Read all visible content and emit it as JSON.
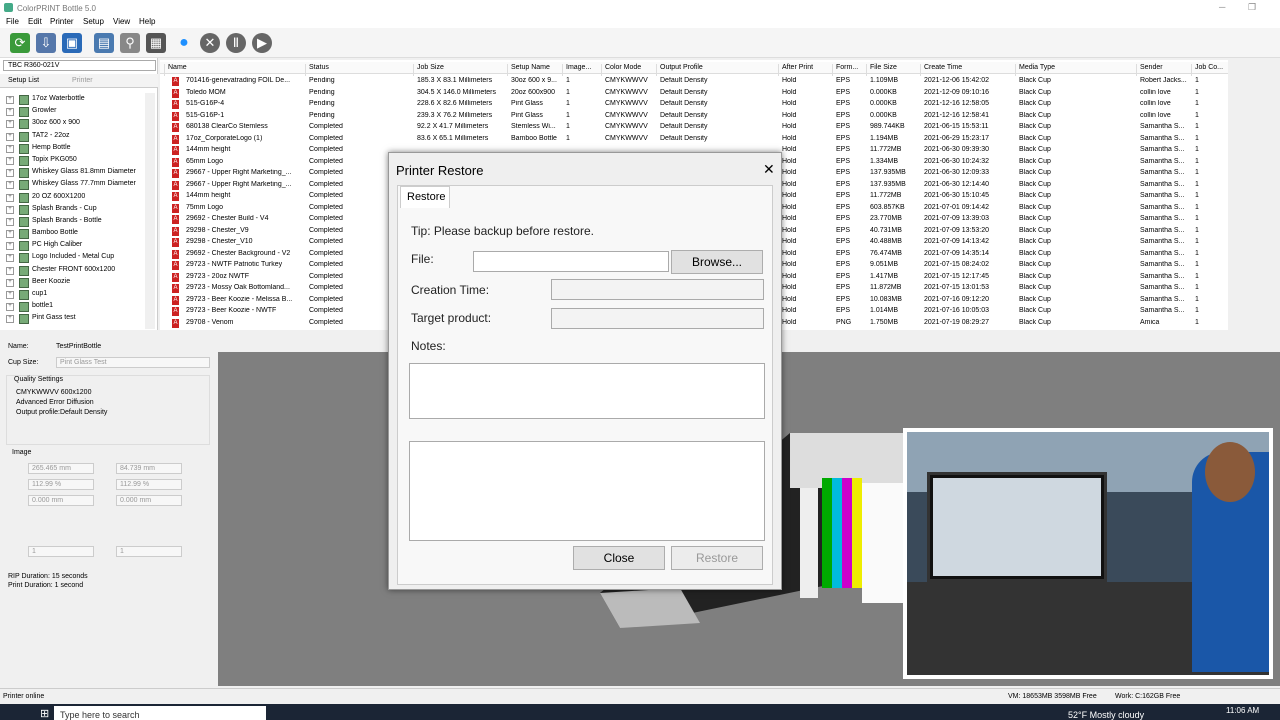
{
  "app": {
    "title": "ColorPRINT Bottle 5.0"
  },
  "menu": [
    "File",
    "Edit",
    "Printer",
    "Setup",
    "View",
    "Help"
  ],
  "printer_select": "TBC R360-021V",
  "left_tabs": {
    "setup_list": "Setup List",
    "printer": "Printer"
  },
  "setups": [
    "17oz Waterbottle",
    "Growler",
    "30oz 600 x 900",
    "TAT2 - 22oz",
    "Hemp Bottle",
    "Topix PKG050",
    "Whiskey Glass 81.8mm Diameter",
    "Whiskey Glass 77.7mm Diameter",
    "20 OZ 600X1200",
    "Splash Brands - Cup",
    "Splash Brands - Bottle",
    "Bamboo Bottle",
    "PC High Caliber",
    "Logo Included - Metal Cup",
    "Chester FRONT 600x1200",
    "Beer Koozie",
    "cup1",
    "bottle1",
    "Pint Gass test"
  ],
  "grid": {
    "headers": [
      "Name",
      "Status",
      "Job Size",
      "Setup Name",
      "Image...",
      "Color Mode",
      "Output Profile",
      "After Print",
      "Form...",
      "File Size",
      "Create Time",
      "Media Type",
      "Sender",
      "Job Co..."
    ],
    "rows": [
      [
        "701416-genevatrading FOIL De...",
        "Pending",
        "185.3 X 83.1 Millimeters",
        "30oz 600 x 9...",
        "1",
        "CMYKWWVV",
        "Default Density",
        "Hold",
        "EPS",
        "1.109MB",
        "2021-12-06 15:42:02",
        "Black Cup",
        "Robert Jacks...",
        "1"
      ],
      [
        "Toledo MOM",
        "Pending",
        "304.5 X 146.0 Millimeters",
        "20oz 600x900",
        "1",
        "CMYKWWVV",
        "Default Density",
        "Hold",
        "EPS",
        "0.000KB",
        "2021-12-09 09:10:16",
        "Black Cup",
        "collin love",
        "1"
      ],
      [
        "515-G16P-4",
        "Pending",
        "228.6 X 82.6 Millimeters",
        "Pint Glass",
        "1",
        "CMYKWWVV",
        "Default Density",
        "Hold",
        "EPS",
        "0.000KB",
        "2021-12-16 12:58:05",
        "Black Cup",
        "collin love",
        "1"
      ],
      [
        "515-G16P-1",
        "Pending",
        "239.3 X 76.2 Millimeters",
        "Pint Glass",
        "1",
        "CMYKWWVV",
        "Default Density",
        "Hold",
        "EPS",
        "0.000KB",
        "2021-12-16 12:58:41",
        "Black Cup",
        "collin love",
        "1"
      ],
      [
        "680138 ClearCo Stemless",
        "Completed",
        "92.2 X 41.7 Millimeters",
        "Stemless Wi...",
        "1",
        "CMYKWWVV",
        "Default Density",
        "Hold",
        "EPS",
        "989.744KB",
        "2021-06-15 15:53:11",
        "Black Cup",
        "Samantha S...",
        "1"
      ],
      [
        "17oz_CorporateLogo (1)",
        "Completed",
        "83.6 X 65.1 Millimeters",
        "Bamboo Bottle",
        "1",
        "CMYKWWVV",
        "Default Density",
        "Hold",
        "EPS",
        "1.194MB",
        "2021-06-29 15:23:17",
        "Black Cup",
        "Samantha S...",
        "1"
      ],
      [
        "144mm height",
        "Completed",
        "",
        "",
        "",
        "",
        "",
        "Hold",
        "EPS",
        "11.772MB",
        "2021-06-30 09:39:30",
        "Black Cup",
        "Samantha S...",
        "1"
      ],
      [
        "65mm Logo",
        "Completed",
        "",
        "",
        "",
        "",
        "",
        "Hold",
        "EPS",
        "1.334MB",
        "2021-06-30 10:24:32",
        "Black Cup",
        "Samantha S...",
        "1"
      ],
      [
        "29667 - Upper Right Marketing_...",
        "Completed",
        "",
        "",
        "",
        "",
        "",
        "Hold",
        "EPS",
        "137.935MB",
        "2021-06-30 12:09:33",
        "Black Cup",
        "Samantha S...",
        "1"
      ],
      [
        "29667 - Upper Right Marketing_...",
        "Completed",
        "",
        "",
        "",
        "",
        "",
        "Hold",
        "EPS",
        "137.935MB",
        "2021-06-30 12:14:40",
        "Black Cup",
        "Samantha S...",
        "1"
      ],
      [
        "144mm height",
        "Completed",
        "",
        "",
        "",
        "",
        "",
        "Hold",
        "EPS",
        "11.772MB",
        "2021-06-30 15:10:45",
        "Black Cup",
        "Samantha S...",
        "1"
      ],
      [
        "75mm Logo",
        "Completed",
        "",
        "",
        "",
        "",
        "",
        "Hold",
        "EPS",
        "603.857KB",
        "2021-07-01 09:14:42",
        "Black Cup",
        "Samantha S...",
        "1"
      ],
      [
        "29692 - Chester Build - V4",
        "Completed",
        "",
        "",
        "",
        "",
        "",
        "Hold",
        "EPS",
        "23.770MB",
        "2021-07-09 13:39:03",
        "Black Cup",
        "Samantha S...",
        "1"
      ],
      [
        "29298 - Chester_V9",
        "Completed",
        "",
        "",
        "",
        "",
        "",
        "Hold",
        "EPS",
        "40.731MB",
        "2021-07-09 13:53:20",
        "Black Cup",
        "Samantha S...",
        "1"
      ],
      [
        "29298 - Chester_V10",
        "Completed",
        "",
        "",
        "",
        "",
        "",
        "Hold",
        "EPS",
        "40.488MB",
        "2021-07-09 14:13:42",
        "Black Cup",
        "Samantha S...",
        "1"
      ],
      [
        "29692 - Chester Background - V2",
        "Completed",
        "",
        "",
        "",
        "",
        "",
        "Hold",
        "EPS",
        "76.474MB",
        "2021-07-09 14:35:14",
        "Black Cup",
        "Samantha S...",
        "1"
      ],
      [
        "29723 - NWTF Patriotic Turkey",
        "Completed",
        "",
        "",
        "",
        "",
        "",
        "Hold",
        "EPS",
        "9.051MB",
        "2021-07-15 08:24:02",
        "Black Cup",
        "Samantha S...",
        "1"
      ],
      [
        "29723 - 20oz NWTF",
        "Completed",
        "",
        "",
        "",
        "",
        "",
        "Hold",
        "EPS",
        "1.417MB",
        "2021-07-15 12:17:45",
        "Black Cup",
        "Samantha S...",
        "1"
      ],
      [
        "29723 - Mossy Oak Bottomland...",
        "Completed",
        "",
        "",
        "",
        "",
        "",
        "Hold",
        "EPS",
        "11.872MB",
        "2021-07-15 13:01:53",
        "Black Cup",
        "Samantha S...",
        "1"
      ],
      [
        "29723 - Beer Koozie - Melissa B...",
        "Completed",
        "",
        "",
        "",
        "",
        "",
        "Hold",
        "EPS",
        "10.083MB",
        "2021-07-16 09:12:20",
        "Black Cup",
        "Samantha S...",
        "1"
      ],
      [
        "29723 - Beer Koozie - NWTF",
        "Completed",
        "",
        "",
        "",
        "",
        "",
        "Hold",
        "EPS",
        "1.014MB",
        "2021-07-16 10:05:03",
        "Black Cup",
        "Samantha S...",
        "1"
      ],
      [
        "29708 - Venom",
        "Completed",
        "",
        "",
        "",
        "",
        "",
        "Hold",
        "PNG",
        "1.750MB",
        "2021-07-19 08:29:27",
        "Black Cup",
        "Amica",
        "1"
      ]
    ]
  },
  "props": {
    "name_label": "Name:",
    "name_value": "TestPrintBottle",
    "cup_label": "Cup Size:",
    "cup_value": "Pint Glass Test",
    "quality_label": "Quality Settings",
    "quality_lines": [
      "CMYKWWVV    600x1200",
      "Advanced Error Diffusion",
      "Output profile:Default Density"
    ],
    "image_label": "Image",
    "w": "265.465 mm",
    "h": "84.739 mm",
    "sx": "112.99 %",
    "sy": "112.99 %",
    "x": "0.000 mm",
    "y": "0.000 mm",
    "c1": "1",
    "c2": "1",
    "rip": "RIP Duration: 15 seconds",
    "print": "Print Duration: 1 second"
  },
  "dialog": {
    "title": "Printer Restore",
    "tab": "Restore",
    "tip": "Tip: Please backup before restore.",
    "file_label": "File:",
    "browse": "Browse...",
    "creation_label": "Creation Time:",
    "target_label": "Target product:",
    "notes_label": "Notes:",
    "close": "Close",
    "restore": "Restore"
  },
  "status": {
    "left": "Printer online",
    "vm": "VM: 18653MB 3598MB Free",
    "work": "Work: C:162GB Free"
  },
  "taskbar": {
    "search": "Type here to search",
    "weather": "52°F  Mostly cloudy",
    "time": "11:06 AM"
  },
  "colors": {
    "accent": "#0078d7",
    "pdf_icon": "#cc2222"
  }
}
